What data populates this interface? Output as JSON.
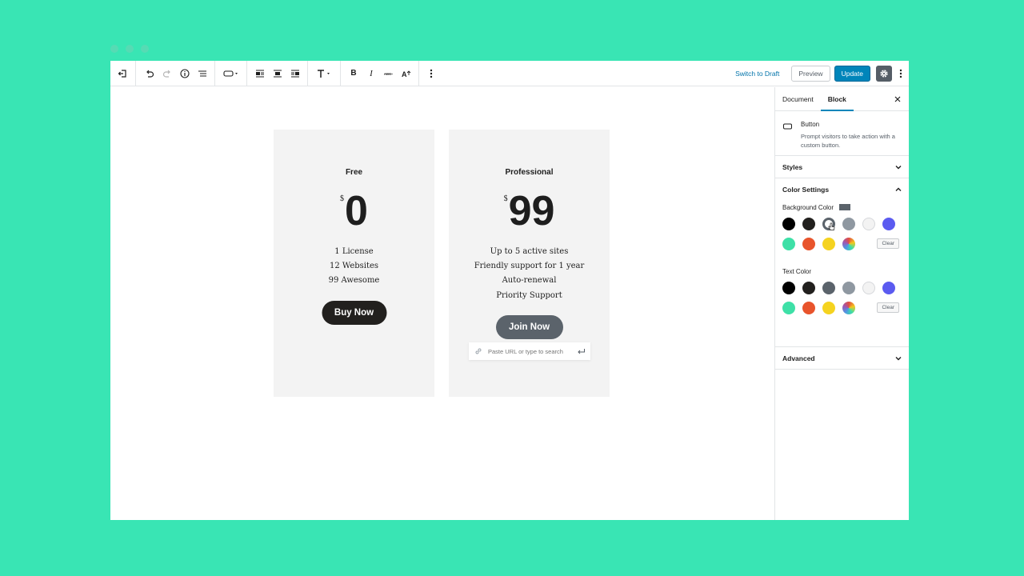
{
  "window": {
    "dots": [
      "dot-1",
      "dot-2",
      "dot-3"
    ]
  },
  "toolbar": {
    "icons": [
      "back-icon",
      "undo-icon",
      "redo-icon",
      "info-icon",
      "list-view-icon",
      "button-block-icon",
      "align-left-icon",
      "align-center-icon",
      "align-right-icon",
      "text-icon",
      "bold-icon",
      "italic-icon",
      "strikethrough-icon",
      "font-size-icon",
      "more-vertical-icon"
    ],
    "switch_to_draft": "Switch to Draft",
    "preview": "Preview",
    "update": "Update"
  },
  "pricing": {
    "free": {
      "name": "Free",
      "currency": "$",
      "amount": "0",
      "features": [
        "1 License",
        "12 Websites",
        "99 Awesome"
      ],
      "button": "Buy Now"
    },
    "pro": {
      "name": "Professional",
      "currency": "$",
      "amount": "99",
      "features": [
        "Up to 5 active sites",
        "Friendly support for 1 year",
        "Auto-renewal",
        "Priority Support"
      ],
      "button": "Join Now",
      "url_placeholder": "Paste URL or type to search"
    }
  },
  "sidebar": {
    "tabs": [
      "Document",
      "Block"
    ],
    "active_tab": "Block",
    "block": {
      "title": "Button",
      "description": "Prompt visitors to take action with a custom button."
    },
    "panels": {
      "styles": "Styles",
      "color_settings": "Color Settings",
      "advanced": "Advanced"
    },
    "background_color_label": "Background Color",
    "text_color_label": "Text Color",
    "clear": "Clear",
    "palette": [
      "#000000",
      "#22201e",
      "#5b636b",
      "#8f98a1",
      "#f3f3f3",
      "#5b5bf0",
      "#3ee0a7",
      "#e8542c",
      "#f5d320",
      "custom"
    ],
    "selected_background": "#5b636b",
    "accent": "#0085ba"
  }
}
